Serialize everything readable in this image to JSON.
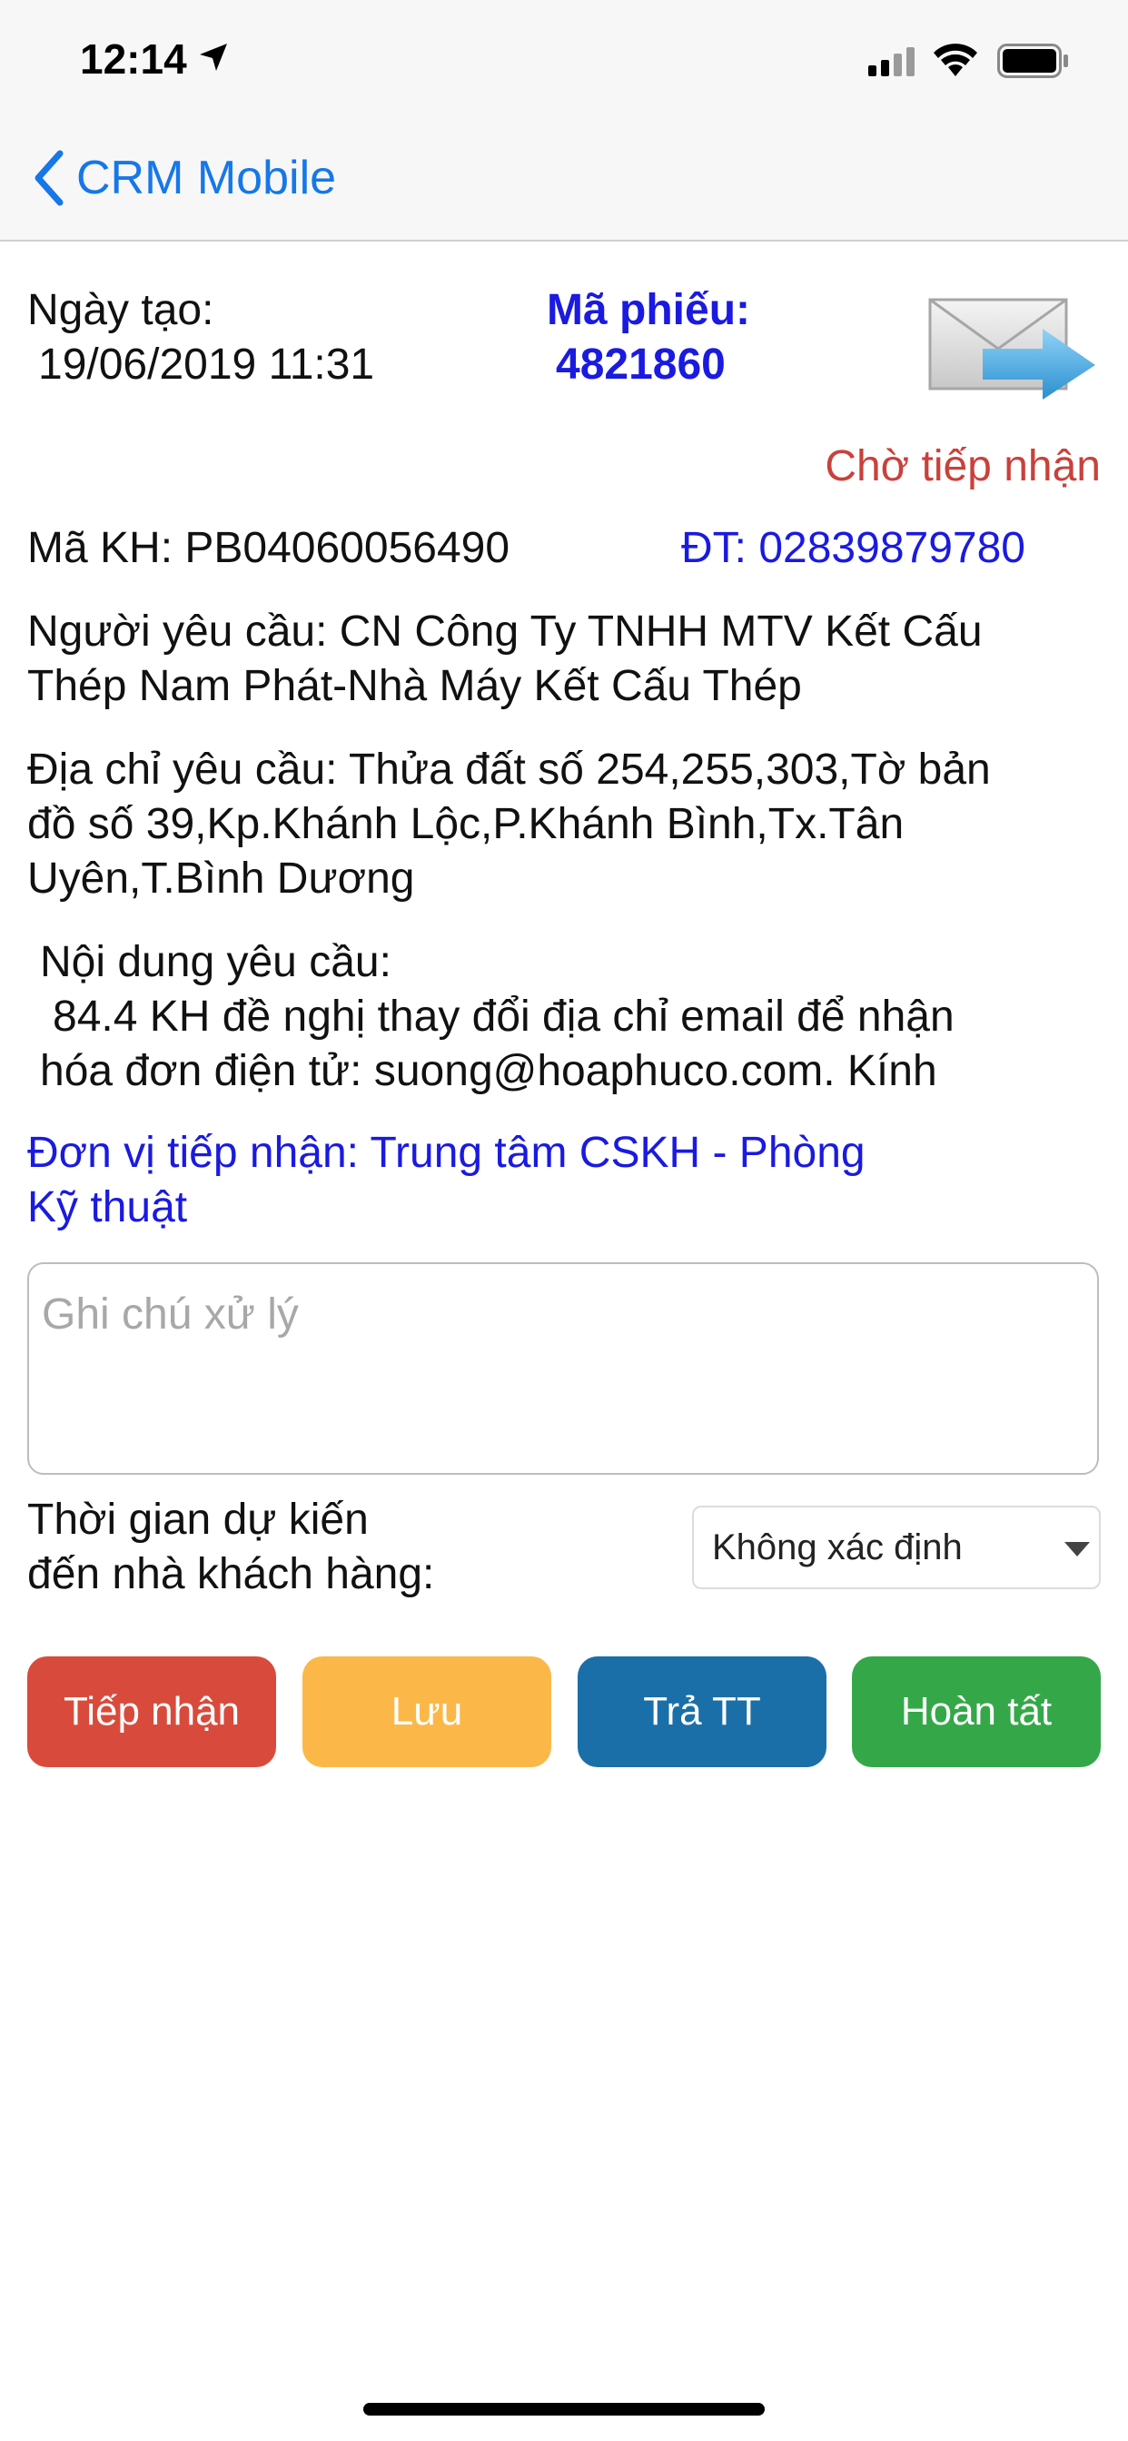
{
  "status_bar": {
    "time": "12:14",
    "icons": [
      "location-arrow-icon",
      "cellular-signal-icon",
      "wifi-icon",
      "battery-icon"
    ]
  },
  "nav": {
    "back_label": "CRM Mobile"
  },
  "ticket": {
    "created_label": "Ngày tạo:",
    "created_value": "19/06/2019 11:31",
    "code_label": "Mã phiếu:",
    "code_value": "4821860",
    "status": "Chờ tiếp nhận",
    "customer_code": "Mã KH: PB04060056490",
    "phone": "ĐT: 02839879780",
    "requester_line1": "Người yêu cầu: CN Công Ty TNHH MTV Kết Cấu",
    "requester_line2": "Thép Nam Phát-Nhà Máy Kết Cấu Thép",
    "address_line1": "Địa chỉ yêu cầu:  Thửa đất số 254,255,303,Tờ bản",
    "address_line2": "đồ số 39,Kp.Khánh Lộc,P.Khánh Bình,Tx.Tân",
    "address_line3": "Uyên,T.Bình Dương",
    "content_label": "Nội dung yêu cầu:",
    "content_line1": "84.4 KH đề nghị thay đổi địa chỉ email để nhận",
    "content_line2": "hóa đơn điện tử: suong@hoaphuco.com. Kính",
    "unit_line1": "Đơn vị tiếp nhận: Trung tâm  CSKH - Phòng",
    "unit_line2": "Kỹ thuật"
  },
  "form": {
    "notes_placeholder": "Ghi chú xử lý",
    "eta_label_line1": "Thời gian dự kiến",
    "eta_label_line2": "đến nhà khách hàng:",
    "eta_selected": "Không xác định"
  },
  "buttons": {
    "receive": "Tiếp nhận",
    "save": "Lưu",
    "return": "Trả TT",
    "complete": "Hoàn tất"
  },
  "colors": {
    "back_blue": "#1677e8",
    "info_blue": "#1a1ae0",
    "status_red": "#c9413b",
    "btn_receive": "#d84b3c",
    "btn_save": "#fbb848",
    "btn_return": "#1a6fa8",
    "btn_complete": "#34a848"
  }
}
